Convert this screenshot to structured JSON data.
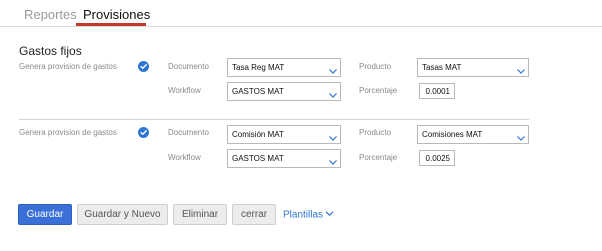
{
  "tabs": [
    {
      "label": "Reportes",
      "active": false
    },
    {
      "label": "Provisiones",
      "active": true
    }
  ],
  "accent_color": "#c0392b",
  "section": {
    "title": "Gastos fijos"
  },
  "rows": [
    {
      "genera_label": "Genera provision de gastos",
      "genera_checked": true,
      "documento_label": "Documento",
      "documento_value": "Tasa Reg MAT",
      "workflow_label": "Workflow",
      "workflow_value": "GASTOS MAT",
      "producto_label": "Producto",
      "producto_value": "Tasas MAT",
      "porcentaje_label": "Porcentaje",
      "porcentaje_value": "0.0001"
    },
    {
      "genera_label": "Genera provision de gastos",
      "genera_checked": true,
      "documento_label": "Documento",
      "documento_value": "Comisión MAT",
      "workflow_label": "Workflow",
      "workflow_value": "GASTOS MAT",
      "producto_label": "Producto",
      "producto_value": "Comisiones MAT",
      "porcentaje_label": "Porcentaje",
      "porcentaje_value": "0.0025"
    }
  ],
  "buttons": {
    "guardar": "Guardar",
    "guardar_nuevo": "Guardar y Nuevo",
    "eliminar": "Eliminar",
    "cerrar": "cerrar"
  },
  "plantillas_label": "Plantillas",
  "icons": {
    "check": "check-circle-icon",
    "chevron": "chevron-down-icon"
  }
}
